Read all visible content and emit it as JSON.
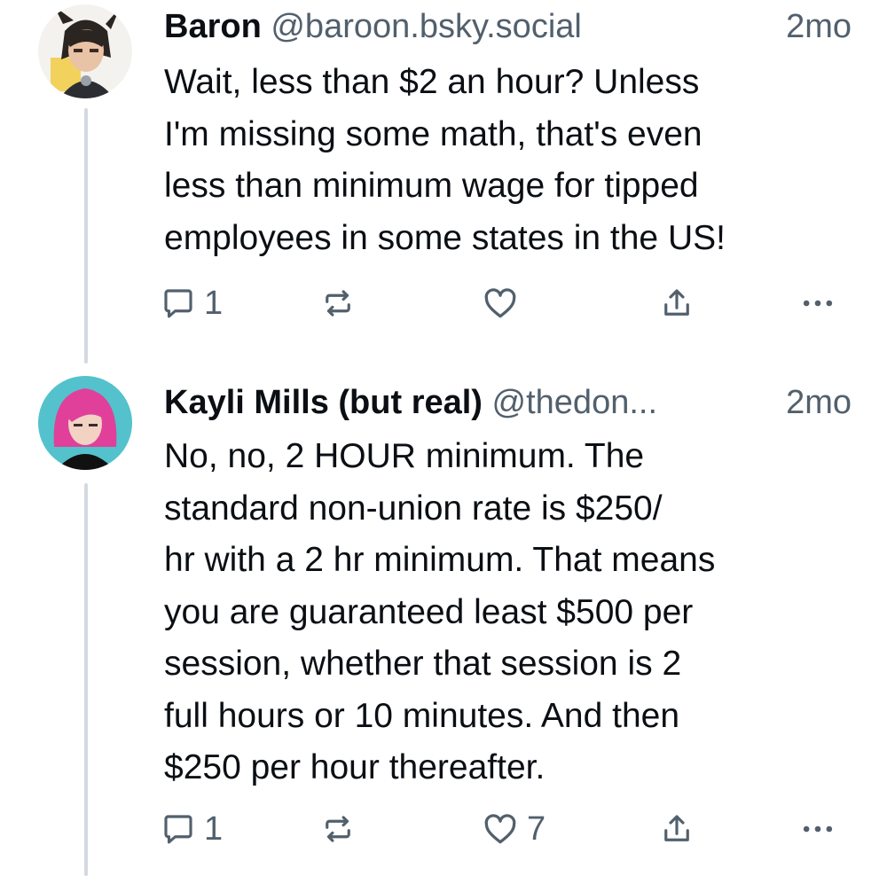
{
  "posts": [
    {
      "author_name": "Baron",
      "handle": "@baroon.bsky.social",
      "time": "2mo",
      "text_lines": [
        "Wait, less than $2 an hour? Unless",
        "I'm missing some math, that's even",
        "less than minimum wage for tipped",
        "employees in some states in the US!"
      ],
      "reply_count": "1",
      "repost_count": "",
      "like_count": "",
      "avatar_icon": "anime-character-avatar"
    },
    {
      "author_name": "Kayli Mills (but real)",
      "handle": "@thedon...",
      "time": "2mo",
      "text_lines": [
        "No, no, 2 HOUR minimum. The",
        "standard non-union rate is $250/",
        "hr with a 2 hr minimum. That means",
        "you are guaranteed least $500 per",
        "session, whether that session is 2",
        "full hours or 10 minutes. And then",
        "$250 per hour thereafter."
      ],
      "reply_count": "1",
      "repost_count": "",
      "like_count": "7",
      "avatar_icon": "pink-hair-person-avatar"
    }
  ],
  "colors": {
    "text": "#0b0f14",
    "muted": "#52606d",
    "thread_line": "#d4d9e1"
  }
}
